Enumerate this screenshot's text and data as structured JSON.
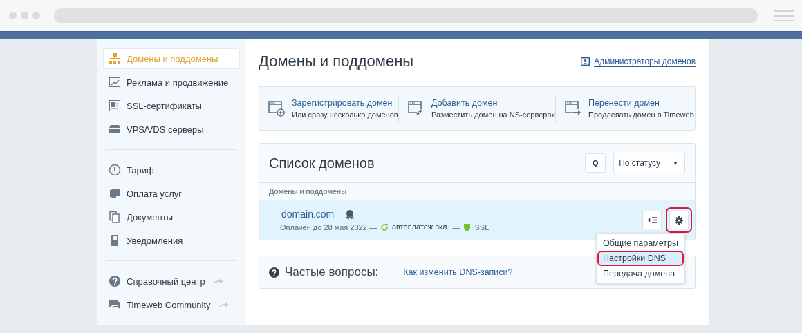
{
  "sidebar": {
    "groups": [
      {
        "items": [
          {
            "label": "Домены и поддомены",
            "selected": true,
            "external": false
          },
          {
            "label": "Реклама и продвижение",
            "selected": false,
            "external": false
          },
          {
            "label": "SSL-сертификаты",
            "selected": false,
            "external": false
          },
          {
            "label": "VPS/VDS серверы",
            "selected": false,
            "external": false
          }
        ]
      },
      {
        "items": [
          {
            "label": "Тариф",
            "selected": false,
            "external": false
          },
          {
            "label": "Оплата услуг",
            "selected": false,
            "external": false
          },
          {
            "label": "Документы",
            "selected": false,
            "external": false
          },
          {
            "label": "Уведомления",
            "selected": false,
            "external": false
          }
        ]
      },
      {
        "items": [
          {
            "label": "Справочный центр",
            "selected": false,
            "external": true
          },
          {
            "label": "Timeweb Community",
            "selected": false,
            "external": true
          }
        ]
      }
    ]
  },
  "page": {
    "title": "Домены и поддомены",
    "admin_link": "Администраторы доменов"
  },
  "actions": [
    {
      "title": "Зарегистрировать домен",
      "subtitle": "Или сразу несколько доменов"
    },
    {
      "title": "Добавить домен",
      "subtitle": "Разместить домен на NS-серверах"
    },
    {
      "title": "Перенести домен",
      "subtitle": "Продлевать домен в Timeweb"
    }
  ],
  "domain_list": {
    "title": "Список доменов",
    "search_button": "Q",
    "filter": "По статусу",
    "filter_caret": "▼",
    "column": "Домены и поддомены",
    "rows": [
      {
        "domain": "domain.com",
        "paid": "Оплачен до 28 мая 2022 —",
        "autopay": "автоплатеж вкл.",
        "separator": "—",
        "ssl": "SSL",
        "settings_highlighted": true
      }
    ]
  },
  "menu": [
    {
      "label": "Общие параметры",
      "selected": false,
      "highlighted": false
    },
    {
      "label": "Настройки DNS",
      "selected": true,
      "highlighted": true
    },
    {
      "label": "Передача домена",
      "selected": false,
      "highlighted": false
    }
  ],
  "faq": {
    "label": "Частые вопросы:",
    "link": "Как изменить DNS-записи?"
  }
}
